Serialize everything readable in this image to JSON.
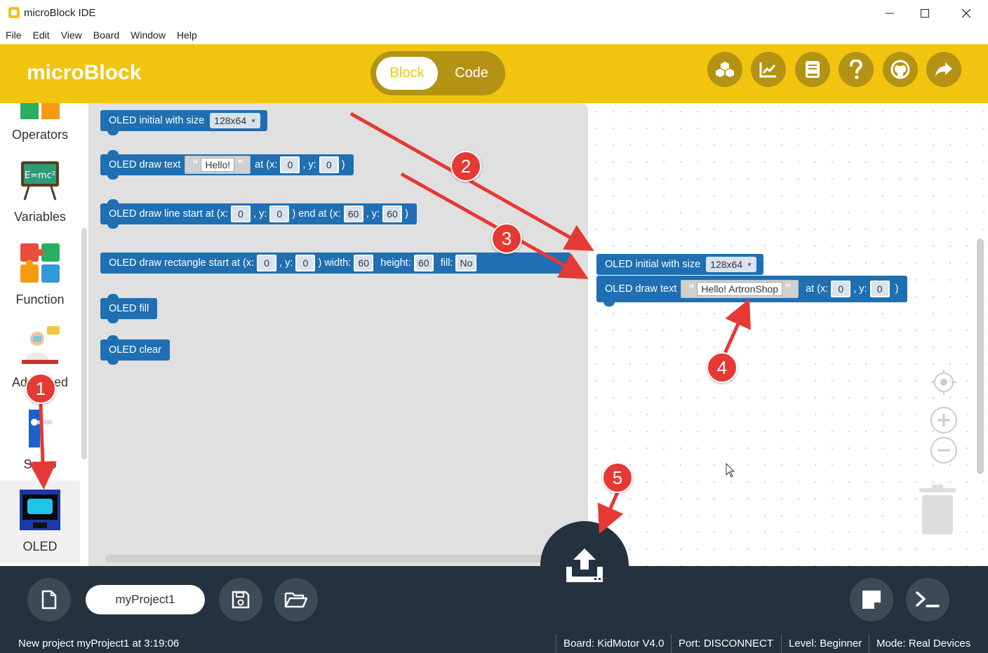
{
  "window": {
    "title": "microBlock IDE"
  },
  "menu": [
    "File",
    "Edit",
    "View",
    "Board",
    "Window",
    "Help"
  ],
  "header": {
    "brand": "microBlock",
    "mode_block": "Block",
    "mode_code": "Code"
  },
  "categories": [
    {
      "label": "Operators",
      "icon": "operators-icon"
    },
    {
      "label": "Variables",
      "icon": "variables-icon"
    },
    {
      "label": "Function",
      "icon": "puzzle-icon"
    },
    {
      "label": "Advanced",
      "icon": "advanced-icon"
    },
    {
      "label": "Servo",
      "icon": "servo-icon"
    },
    {
      "label": "OLED",
      "icon": "oled-icon",
      "active": true
    }
  ],
  "flyout": {
    "init_label": "OLED initial with size",
    "init_size": "128x64",
    "text_label": "OLED draw text",
    "text_value": "Hello!",
    "at_x": "at (x:",
    "y_label": ", y:",
    "close": ")",
    "text_x": "0",
    "text_y": "0",
    "line_label": "OLED draw line start at (x:",
    "line_x1": "0",
    "line_y1": "0",
    "end_at": ") end at (x:",
    "line_x2": "60",
    "line_y2": "60",
    "rect_label": "OLED draw rectangle start at (x:",
    "rect_x": "0",
    "rect_y": "0",
    "width_label": ") width:",
    "rect_w": "60",
    "height_label": "height:",
    "rect_h": "60",
    "fill_label": "fill:",
    "fill_value": "No",
    "fill_block": "OLED fill",
    "clear_block": "OLED clear"
  },
  "workspace": {
    "init_label": "OLED initial with size",
    "init_size": "128x64",
    "text_label": "OLED draw text",
    "text_value": "Hello! ArtronShop",
    "at_x": "at (x:",
    "text_x": "0",
    "y_label": ", y:",
    "text_y": "0",
    "close": ")"
  },
  "bottom": {
    "project_name": "myProject1"
  },
  "status": {
    "message": "New project myProject1 at 3:19:06",
    "board": "Board: KidMotor V4.0",
    "port": "Port: DISCONNECT",
    "level": "Level: Beginner",
    "mode": "Mode: Real Devices"
  },
  "annotations": [
    "1",
    "2",
    "3",
    "4",
    "5"
  ],
  "colors": {
    "header": "#f1c40f",
    "block": "#1f6fb2",
    "dark": "#243240",
    "annotation": "#e53935"
  }
}
